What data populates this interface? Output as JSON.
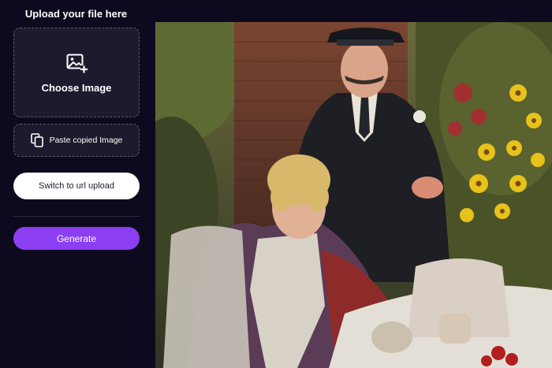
{
  "sidebar": {
    "title": "Upload your file here",
    "choose_image_label": "Choose Image",
    "paste_label": "Paste copied Image",
    "switch_url_label": "Switch to url upload",
    "generate_label": "Generate"
  },
  "icons": {
    "choose_image": "image-add-icon",
    "paste": "copy-icon"
  },
  "colors": {
    "background": "#0d0a1f",
    "panel": "#1c1a2c",
    "dashed_border": "#5a5670",
    "accent": "#8c3ff2",
    "url_button": "#ffffff"
  }
}
